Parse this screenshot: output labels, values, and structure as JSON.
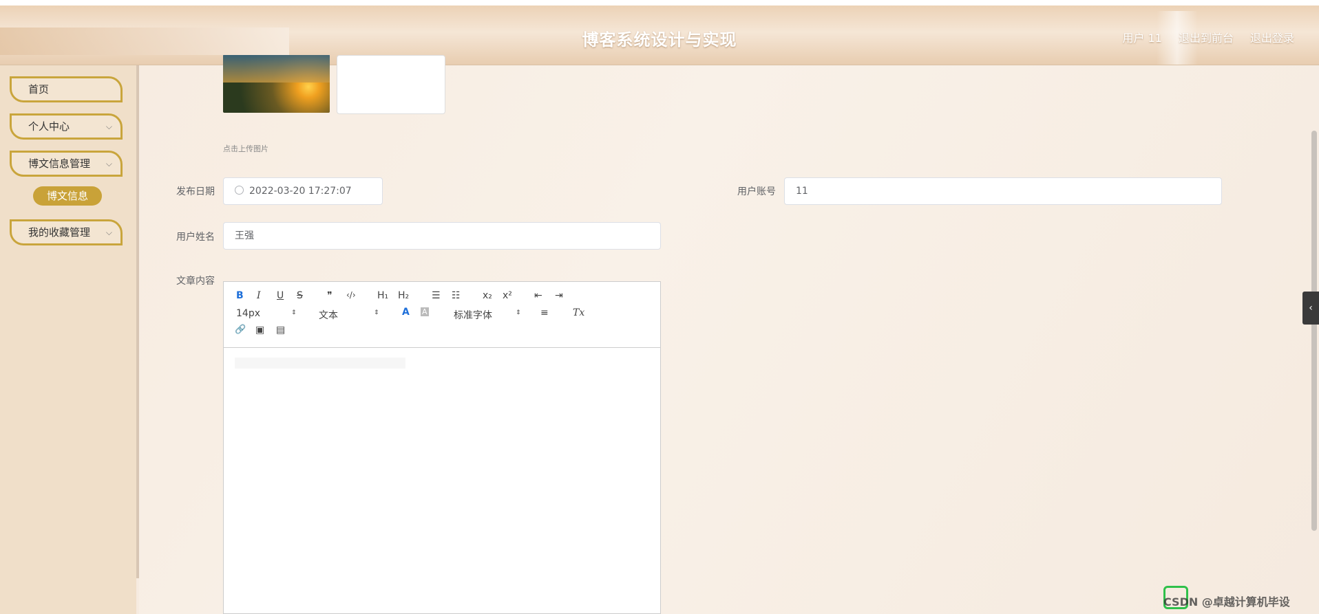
{
  "header": {
    "app_title": "博客系统设计与实现",
    "user_label": "用户 11",
    "back_to_front": "退出到前台",
    "logout": "退出登录"
  },
  "sidebar": {
    "items": [
      {
        "label": "首页",
        "has_arrow": false
      },
      {
        "label": "个人中心",
        "has_arrow": true
      },
      {
        "label": "博文信息管理",
        "has_arrow": true
      },
      {
        "label": "我的收藏管理",
        "has_arrow": true
      }
    ],
    "sub_item": "博文信息",
    "chevron": "⌵"
  },
  "form": {
    "upload_tip": "点击上传图片",
    "publish_date_label": "发布日期",
    "publish_date_value": "2022-03-20 17:27:07",
    "account_label": "用户账号",
    "account_value": "11",
    "username_label": "用户姓名",
    "username_value": "王强",
    "content_label": "文章内容"
  },
  "editor": {
    "toolbar": {
      "bold": "B",
      "italic": "I",
      "underline": "U",
      "strike": "S",
      "quote": "❞",
      "code": "‹/›",
      "h1": "H₁",
      "h2": "H₂",
      "ordered_list": "☰",
      "bullet_list": "☷",
      "subscript": "x₂",
      "superscript": "x²",
      "outdent": "⇤",
      "indent": "⇥",
      "font_size": "14px",
      "block_type": "文本",
      "font_color": "A",
      "bg_color": "A",
      "font_family": "标准字体",
      "align": "≡",
      "clear_format": "Tx",
      "link": "🔗",
      "image": "▣",
      "video": "▤",
      "select_arrow": "⇕"
    }
  },
  "side_toggle": "‹",
  "watermark": "CSDN @卓越计算机毕设",
  "colors": {
    "accent_gold": "#c9a238",
    "sidebar_bg": "#f0dfc9",
    "content_bg": "#f7ece1"
  }
}
